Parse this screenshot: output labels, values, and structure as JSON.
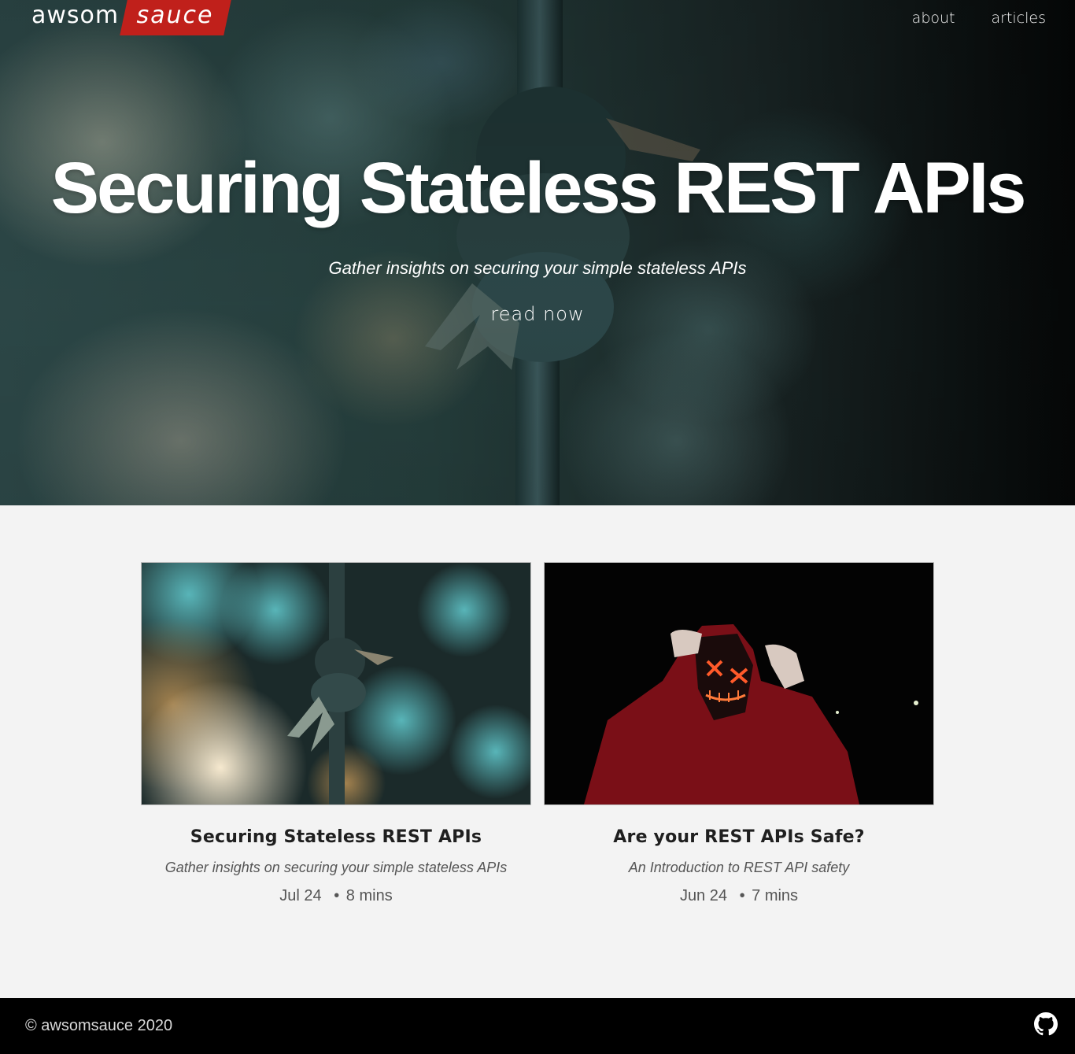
{
  "header": {
    "logo_part1": "awsom",
    "logo_part2": "sauce",
    "nav": [
      {
        "label": "about"
      },
      {
        "label": "articles"
      }
    ]
  },
  "hero": {
    "title": "Securing Stateless REST APIs",
    "subtitle": "Gather insights on securing your simple stateless APIs",
    "cta": "read now"
  },
  "articles": [
    {
      "title": "Securing Stateless REST APIs",
      "subtitle": "Gather insights on securing your simple stateless APIs",
      "date": "Jul 24",
      "separator": "•",
      "read_time": "8 mins",
      "image": "rope-knot-bokeh"
    },
    {
      "title": "Are your REST APIs Safe?",
      "subtitle": "An Introduction to REST API safety",
      "date": "Jun 24",
      "separator": "•",
      "read_time": "7 mins",
      "image": "hooded-figure-neon-mask"
    }
  ],
  "footer": {
    "copyright": "© awsomsauce 2020",
    "icon": "github-icon"
  },
  "colors": {
    "brand_red": "#c0201b",
    "footer_bg": "#000000",
    "page_bg": "#f3f3f3"
  }
}
